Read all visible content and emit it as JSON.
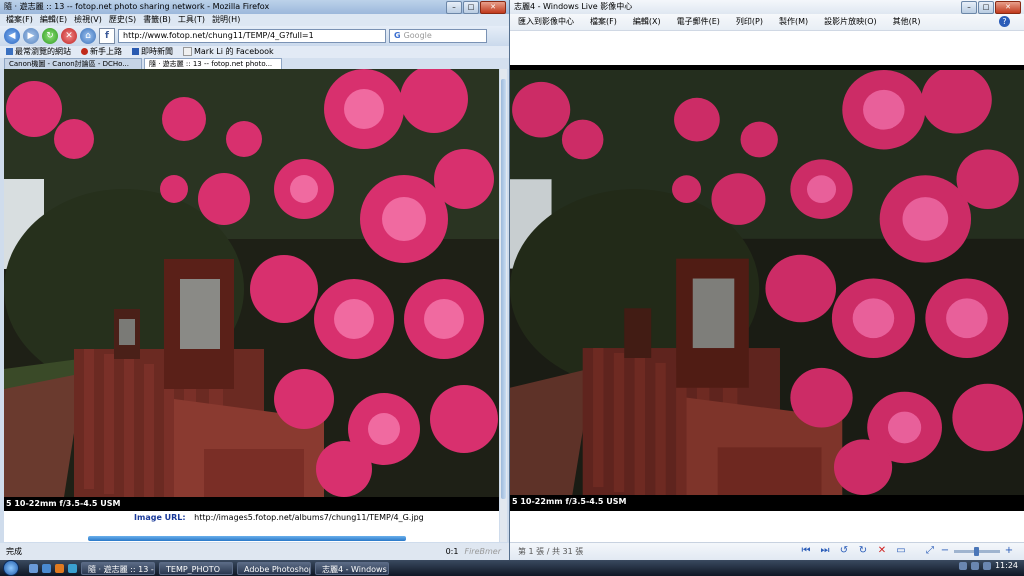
{
  "firefox": {
    "title": "隨 · 遊志麗 :: 13 -- fotop.net photo sharing network - Mozilla Firefox",
    "menu": [
      "檔案(F)",
      "編輯(E)",
      "檢視(V)",
      "歷史(S)",
      "書籤(B)",
      "工具(T)",
      "說明(H)"
    ],
    "url": "http://www.fotop.net/chung11/TEMP/4_G?full=1",
    "search_placeholder": "Google",
    "bookmarks": [
      "最常瀏覽的網站",
      "新手上路",
      "即時新聞",
      "Mark Li 的 Facebook"
    ],
    "tabs": [
      "Canon機圖 - Canon討論區 - DCHo...",
      "隨 · 遊志麗 :: 13 -- fotop.net photo..."
    ],
    "caption": "5 10-22mm f/3.5-4.5 USM",
    "image_url_label": "Image URL:",
    "image_url": "http://images5.fotop.net/albums7/chung11/TEMP/4_G.jpg",
    "status": "完成",
    "status_right": "0:1",
    "firebug": "FireBmer"
  },
  "photogallery": {
    "title": "志麗4 - Windows Live 影像中心",
    "menu": [
      "匯入到影像中心",
      "檔案(F)",
      "編輯(X)",
      "電子郵件(E)",
      "列印(P)",
      "製作(M)",
      "設影片放映(O)",
      "其他(R)"
    ],
    "help": "?",
    "caption": "5 10-22mm f/3.5-4.5 USM",
    "page_info": "第 1 張 / 共 31 張",
    "controls": [
      "⏮",
      "⏭",
      "↺",
      "↻",
      "✕",
      "▭"
    ]
  },
  "taskbar": {
    "buttons": [
      "隨 · 遊志麗 :: 13 -- f...",
      "TEMP_PHOTO",
      "Adobe Photoshop ...",
      "志麗4 - Windows Li..."
    ],
    "clock": "11:24"
  }
}
